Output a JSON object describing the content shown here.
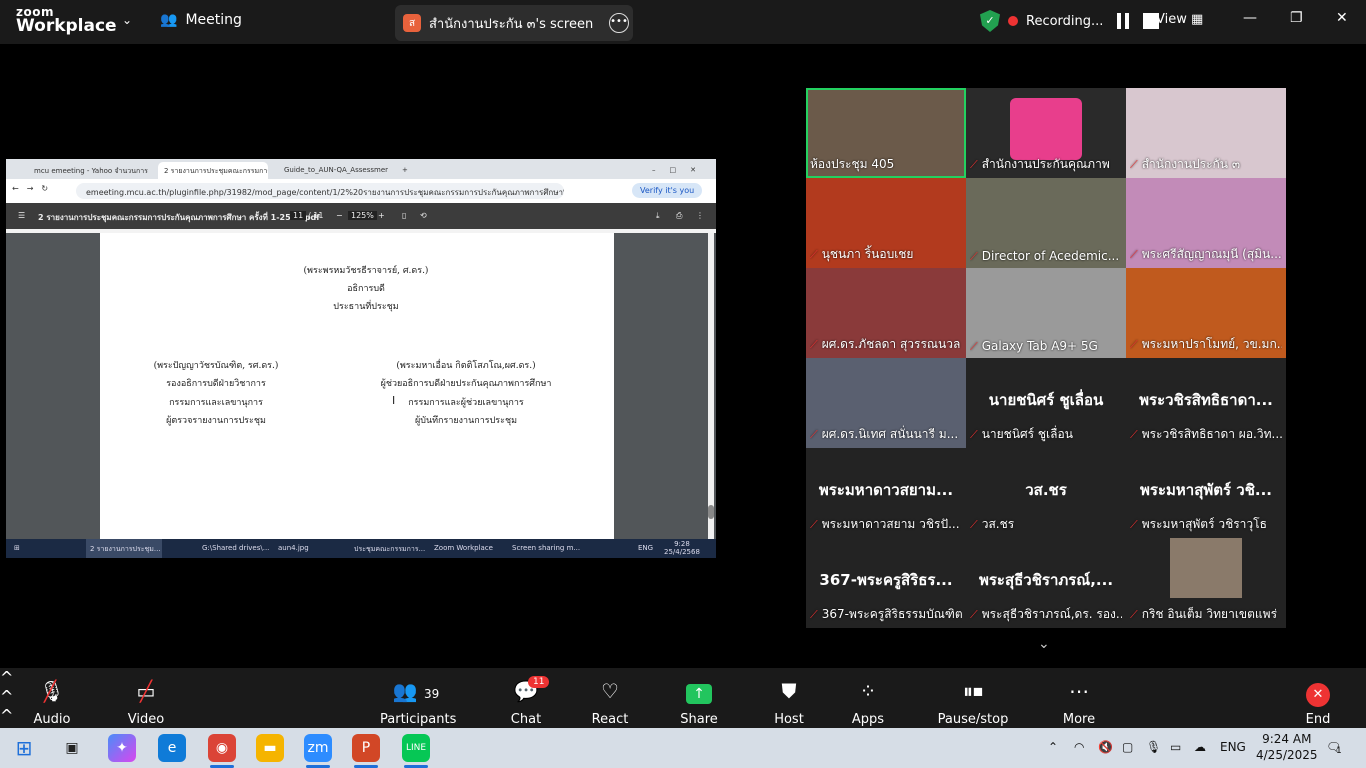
{
  "zoom": {
    "brand_top": "zoom",
    "brand_bottom": "Workplace",
    "meeting_label": "Meeting",
    "share_initial": "ส",
    "share_title": "สำนักงานประกัน ๓'s screen",
    "recording_label": "Recording...",
    "view_label": "View"
  },
  "browser": {
    "tabs": [
      "mcu emeeting - Yahoo จำนวนการค้น",
      "2 รายงานการประชุมคณะกรรมการประ",
      "Guide_to_AUN-QA_Assessment..."
    ],
    "url": "emeeting.mcu.ac.th/pluginfile.php/31982/mod_page/content/1/2%20รายงานการประชุมคณะกรรมการประกันคุณภาพการศึกษา%20ครั้งที่%201-2568...",
    "verify": "Verify it's you"
  },
  "pdf": {
    "filename": "2 รายงานการประชุมคณะกรรมการประกันคุณภาพการศึกษา ครั้งที่ 1-2568.pdf",
    "page": "11",
    "total": "/ 11",
    "zoom": "125%",
    "lines": {
      "c1": "(พระพรหมวัชรธีราจารย์, ศ.ดร.)",
      "c2": "อธิการบดี",
      "c3": "ประธานที่ประชุม",
      "l1": "(พระปัญญาวัชรบัณฑิต, รศ.ดร.)",
      "l2": "รองอธิการบดีฝ่ายวิชาการ",
      "l3": "กรรมการและเลขานุการ",
      "l4": "ผู้ตรวจรายงานการประชุม",
      "r1": "(พระมหาเอื่อน กิตติโสภโณ,ผศ.ดร.)",
      "r2": "ผู้ช่วยอธิการบดีฝ่ายประกันคุณภาพการศึกษา",
      "r3": "กรรมการและผู้ช่วยเลขานุการ",
      "r4": "ผู้บันทึกรายงานการประชุม"
    }
  },
  "inner_taskbar": {
    "items": [
      "2 รายงานการประชุม...",
      "G:\\Shared drives\\...",
      "aun4.jpg",
      "ประชุมคณะกรรมการ...",
      "Zoom Workplace",
      "Screen sharing m..."
    ],
    "lang": "ENG",
    "time": "9:28",
    "date": "25/4/2568"
  },
  "gallery": {
    "tiles": [
      {
        "name": "ห้องประชุม 405",
        "big": ""
      },
      {
        "name": "สำนักงานประกันคุณภาพ",
        "big": ""
      },
      {
        "name": "สำนักงานประกัน ๓",
        "big": ""
      },
      {
        "name": "นุชนภา ริ้นอบเชย",
        "big": ""
      },
      {
        "name": "Director of Acedemic...",
        "big": ""
      },
      {
        "name": "พระศรีสัญญาณมุนี (สุมิน...",
        "big": ""
      },
      {
        "name": "ผศ.ดร.ภัชลดา สุวรรณนวล",
        "big": ""
      },
      {
        "name": "Galaxy Tab A9+ 5G",
        "big": ""
      },
      {
        "name": "พระมหาปราโมทย์, วข.มก...",
        "big": ""
      },
      {
        "name": "ผศ.ดร.นิเทศ สนั่นนารี ม...",
        "big": ""
      },
      {
        "name": "นายชนิศร์ ชูเลื่อน",
        "big": "นายชนิศร์ ชูเลื่อน"
      },
      {
        "name": "พระวชิรสิทธิธาดา ผอ.วิท...",
        "big": "พระวชิรสิทธิธาดา..."
      },
      {
        "name": "พระมหาดาวสยาม วชิรปั...",
        "big": "พระมหาดาวสยาม..."
      },
      {
        "name": "วส.ชร",
        "big": "วส.ชร"
      },
      {
        "name": "พระมหาสุพัตร์ วชิราวุโธ",
        "big": "พระมหาสุพัตร์ วชิ..."
      },
      {
        "name": "367-พระครูสิริธรรมบัณฑิต",
        "big": "367-พระครูสิริธร..."
      },
      {
        "name": "พระสุธีวชิราภรณ์,ดร. รอง...",
        "big": "พระสุธีวชิราภรณ์,..."
      },
      {
        "name": "กริช อินเต็ม วิทยาเขตแพร่",
        "big": ""
      }
    ]
  },
  "toolbar": {
    "audio": "Audio",
    "video": "Video",
    "participants": "Participants",
    "participants_count": "39",
    "chat": "Chat",
    "chat_badge": "11",
    "react": "React",
    "share": "Share",
    "host_tools": "Host tools",
    "apps": "Apps",
    "pause_recording": "Pause/stop recording",
    "more": "More",
    "end": "End"
  },
  "taskbar": {
    "lang": "ENG",
    "time": "9:24 AM",
    "date": "4/25/2025",
    "notif_count": "1"
  }
}
